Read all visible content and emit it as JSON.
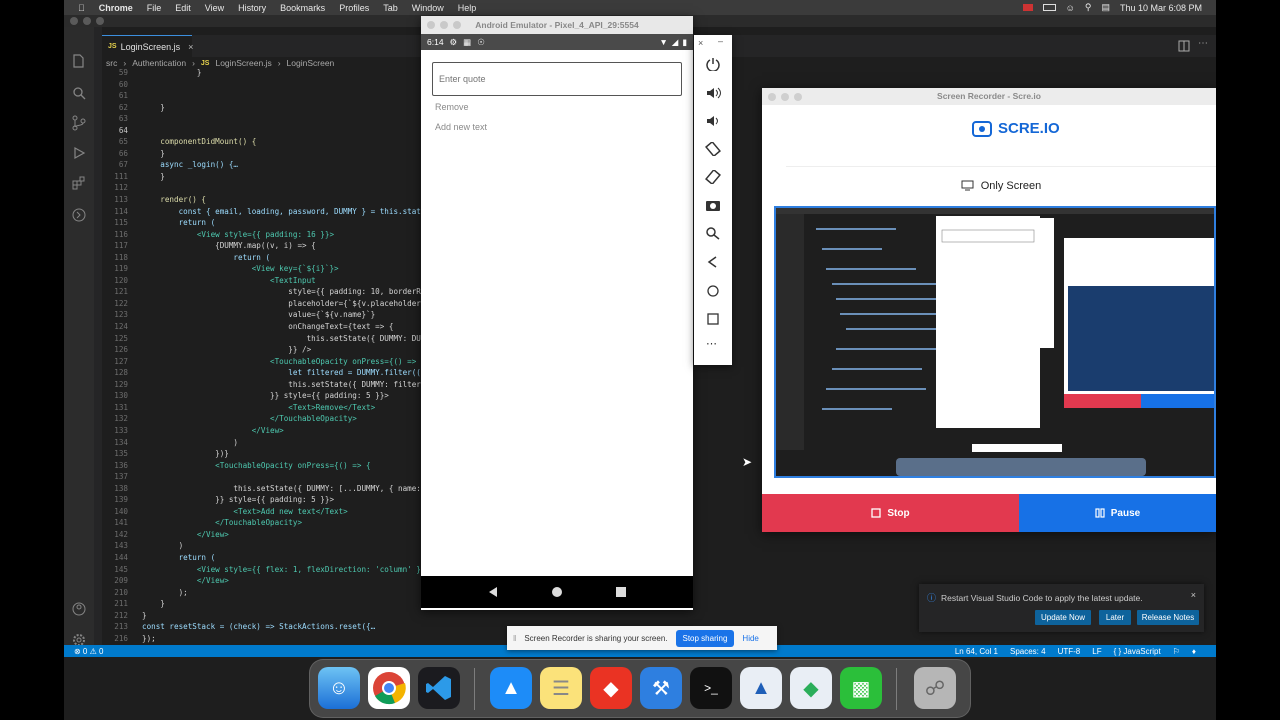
{
  "menubar": {
    "app": "Chrome",
    "items": [
      "File",
      "Edit",
      "View",
      "History",
      "Bookmarks",
      "Profiles",
      "Tab",
      "Window",
      "Help"
    ],
    "clock": "Thu 10 Mar  6:08 PM"
  },
  "vscode": {
    "tab_label": "LoginScreen.js",
    "breadcrumb": [
      "src",
      "Authentication",
      "LoginScreen.js",
      "LoginScreen"
    ],
    "code_lines": [
      {
        "n": "59",
        "t": "            }"
      },
      {
        "n": "60",
        "t": ""
      },
      {
        "n": "61",
        "t": ""
      },
      {
        "n": "62",
        "t": "    }"
      },
      {
        "n": "63",
        "t": ""
      },
      {
        "n": "64",
        "t": ""
      },
      {
        "n": "65",
        "t": "    componentDidMount() {"
      },
      {
        "n": "66",
        "t": "    }"
      },
      {
        "n": "67",
        "t": "    async _login() {…"
      },
      {
        "n": "111",
        "t": "    }"
      },
      {
        "n": "112",
        "t": ""
      },
      {
        "n": "113",
        "t": "    render() {"
      },
      {
        "n": "114",
        "t": "        const { email, loading, password, DUMMY } = this.stat"
      },
      {
        "n": "115",
        "t": "        return ("
      },
      {
        "n": "116",
        "t": "            <View style={{ padding: 16 }}>"
      },
      {
        "n": "117",
        "t": "                {DUMMY.map((v, i) => {"
      },
      {
        "n": "118",
        "t": "                    return ("
      },
      {
        "n": "119",
        "t": "                        <View key={`${i}`}>"
      },
      {
        "n": "120",
        "t": "                            <TextInput"
      },
      {
        "n": "121",
        "t": "                                style={{ padding: 10, borderR"
      },
      {
        "n": "122",
        "t": "                                placeholder={`${v.placeholder"
      },
      {
        "n": "123",
        "t": "                                value={`${v.name}`}"
      },
      {
        "n": "124",
        "t": "                                onChangeText={text => {"
      },
      {
        "n": "125",
        "t": "                                    this.setState({ DUMMY: DU"
      },
      {
        "n": "126",
        "t": "                                }} />"
      },
      {
        "n": "127",
        "t": "                            <TouchableOpacity onPress={() =>"
      },
      {
        "n": "128",
        "t": "                                let filtered = DUMMY.filter(("
      },
      {
        "n": "129",
        "t": "                                this.setState({ DUMMY: filter"
      },
      {
        "n": "130",
        "t": "                            }} style={{ padding: 5 }}>"
      },
      {
        "n": "131",
        "t": "                                <Text>Remove</Text>"
      },
      {
        "n": "132",
        "t": "                            </TouchableOpacity>"
      },
      {
        "n": "133",
        "t": "                        </View>"
      },
      {
        "n": "134",
        "t": "                    )"
      },
      {
        "n": "135",
        "t": "                })}"
      },
      {
        "n": "136",
        "t": "                <TouchableOpacity onPress={() => {"
      },
      {
        "n": "137",
        "t": ""
      },
      {
        "n": "138",
        "t": "                    this.setState({ DUMMY: [...DUMMY, { name:"
      },
      {
        "n": "139",
        "t": "                }} style={{ padding: 5 }}>"
      },
      {
        "n": "140",
        "t": "                    <Text>Add new text</Text>"
      },
      {
        "n": "141",
        "t": "                </TouchableOpacity>"
      },
      {
        "n": "142",
        "t": "            </View>"
      },
      {
        "n": "143",
        "t": "        )"
      },
      {
        "n": "144",
        "t": "        return ("
      },
      {
        "n": "145",
        "t": "            <View style={{ flex: 1, flexDirection: 'column' }}"
      },
      {
        "n": "209",
        "t": "            </View>"
      },
      {
        "n": "210",
        "t": "        );"
      },
      {
        "n": "211",
        "t": "    }"
      },
      {
        "n": "212",
        "t": "}"
      },
      {
        "n": "213",
        "t": "const resetStack = (check) => StackActions.reset({…"
      },
      {
        "n": "216",
        "t": "});"
      }
    ],
    "status_left": "⊗ 0 ⚠ 0",
    "status_right": [
      "Ln 64, Col 1",
      "Spaces: 4",
      "UTF-8",
      "LF",
      "{ } JavaScript"
    ],
    "notification": {
      "message": "Restart Visual Studio Code to apply the latest update.",
      "buttons": [
        "Update Now",
        "Later",
        "Release Notes"
      ]
    }
  },
  "emulator": {
    "title": "Android Emulator - Pixel_4_API_29:5554",
    "time": "6:14",
    "input_placeholder": "Enter quote",
    "remove_label": "Remove",
    "add_label": "Add new text"
  },
  "recorder": {
    "title": "Screen Recorder - Scre.io",
    "logo": "SCRE.IO",
    "mode": "Only Screen",
    "stop": "Stop",
    "pause": "Pause"
  },
  "sharebar": {
    "message": "Screen Recorder is sharing your screen.",
    "stop": "Stop sharing",
    "hide": "Hide"
  },
  "colors": {
    "vscode_status": "#007acc",
    "stop": "#e2394f",
    "pause": "#1771e6",
    "brand": "#1467d6"
  }
}
